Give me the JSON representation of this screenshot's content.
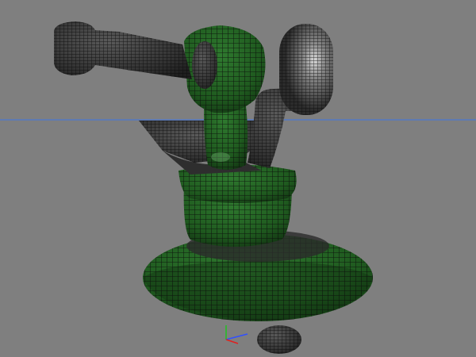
{
  "viewport": {
    "background_color": "#7f7f7f",
    "horizon_color": "#4a78d0",
    "mesh_shaded_color": "#1f5a1f",
    "mesh_shadow_color": "#2c2c2c",
    "wire_color": "#0a0a0a",
    "highlight_color": "#dadada"
  },
  "axis_gizmo": {
    "x_color": "#3050ff",
    "y_color": "#20c020",
    "z_color": "#e02020"
  }
}
